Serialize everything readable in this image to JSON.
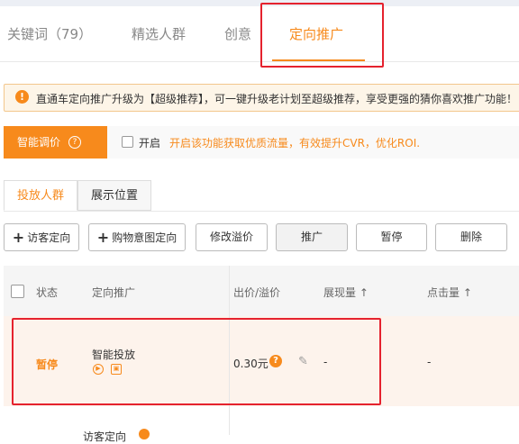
{
  "tabs": [
    {
      "label": "关键词（79）"
    },
    {
      "label": "精选人群"
    },
    {
      "label": "创意"
    },
    {
      "label": "定向推广",
      "active": true
    }
  ],
  "notice": {
    "text": "直通车定向推广升级为【超级推荐】，可一键升级老计划至超级推荐，享受更强的猜你喜欢推广功能！"
  },
  "smart_bid": {
    "label": "智能调价",
    "enable_label": "开启",
    "enable_checked": false,
    "description": "开启该功能获取优质流量，有效提升CVR，优化ROI."
  },
  "subtabs": [
    {
      "label": "投放人群",
      "active": true
    },
    {
      "label": "展示位置"
    }
  ],
  "toolbar": {
    "visitor_targeting": "访客定向",
    "purchase_intent_targeting": "购物意图定向",
    "modify_premium": "修改溢价",
    "promote": "推广",
    "pause": "暂停",
    "delete": "删除"
  },
  "table": {
    "headers": {
      "status": "状态",
      "targeting": "定向推广",
      "bid": "出价/溢价",
      "impressions": "展现量 ↑",
      "clicks": "点击量 ↑"
    },
    "rows": [
      {
        "status": "暂停",
        "name": "智能投放",
        "bid": "0.30元",
        "impressions": "-",
        "clicks": "-"
      }
    ],
    "partial_next_row": "访客定向"
  },
  "colors": {
    "accent": "#f78a1c",
    "highlight": "#e5222e",
    "row_bg": "#fdf3ec"
  }
}
